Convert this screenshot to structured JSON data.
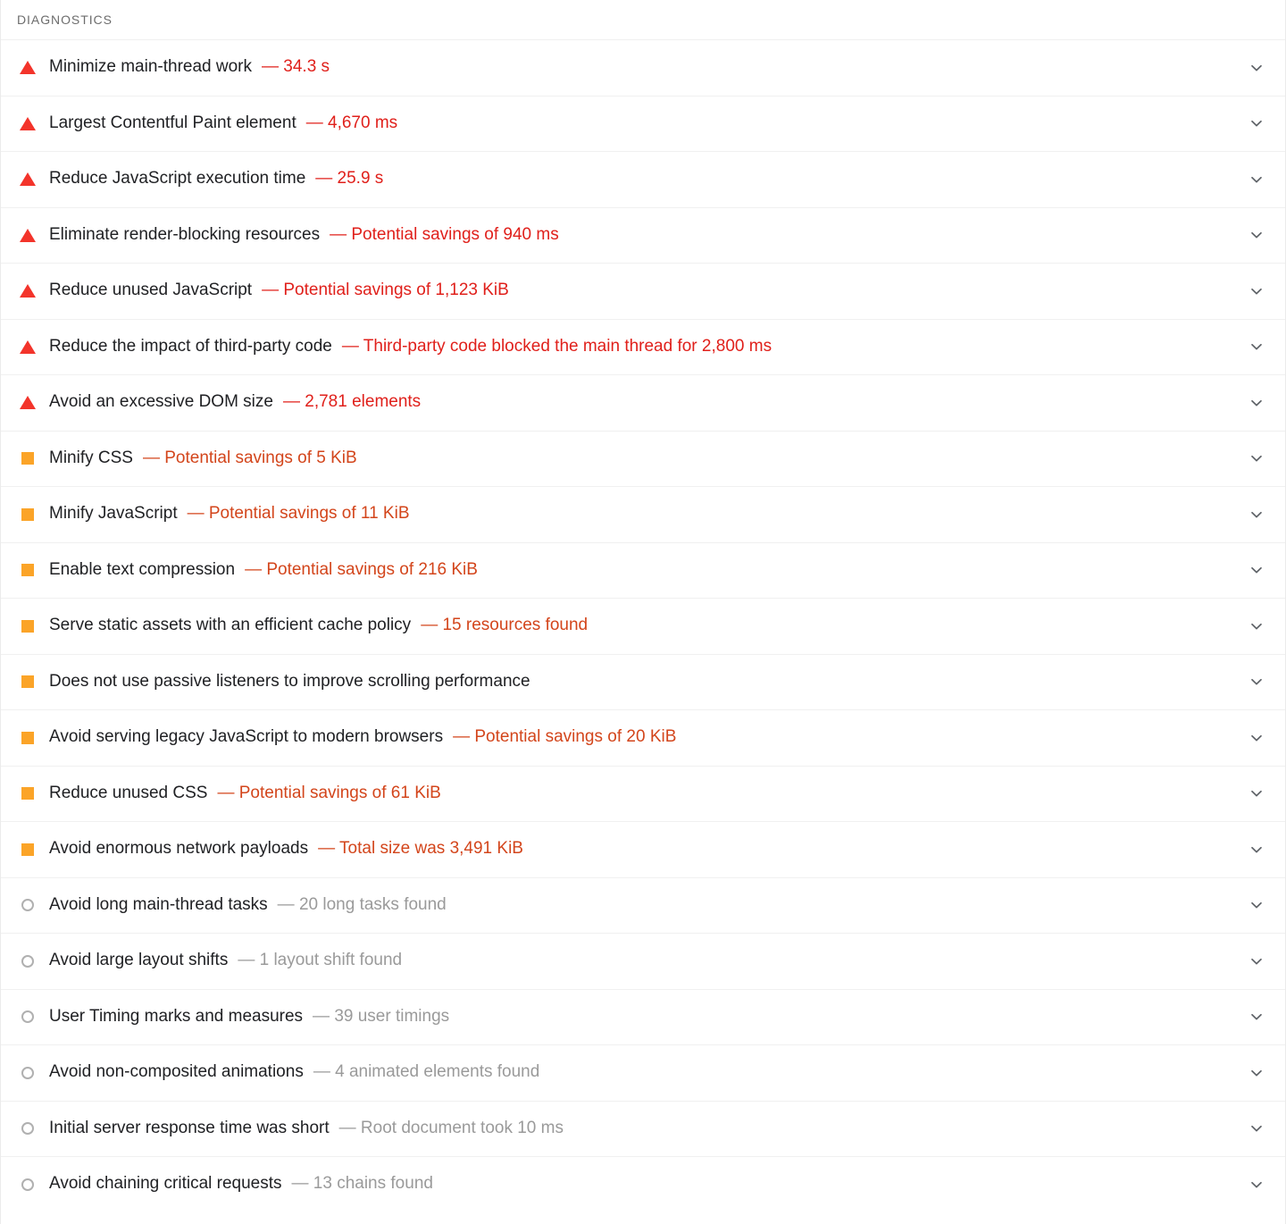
{
  "section": {
    "header_label": "DIAGNOSTICS"
  },
  "colors": {
    "error": "#e0201b",
    "error_icon": "#f3342b",
    "warning": "#d3451b",
    "warning_icon": "#fba428",
    "pass": "#9a9a9a",
    "pass_icon": "#b0b0b0",
    "title_text": "#202124",
    "header_text": "#6d6d6d",
    "row_divider": "#f0f0f0"
  },
  "icons": {
    "error": "red-triangle-icon",
    "warning": "orange-square-icon",
    "pass": "gray-circle-icon",
    "expand": "chevron-down-icon"
  },
  "audits": [
    {
      "severity": "error",
      "title": "Minimize main-thread work",
      "value": "— 34.3 s"
    },
    {
      "severity": "error",
      "title": "Largest Contentful Paint element",
      "value": "— 4,670 ms"
    },
    {
      "severity": "error",
      "title": "Reduce JavaScript execution time",
      "value": "— 25.9 s"
    },
    {
      "severity": "error",
      "title": "Eliminate render-blocking resources",
      "value": "— Potential savings of 940 ms"
    },
    {
      "severity": "error",
      "title": "Reduce unused JavaScript",
      "value": "— Potential savings of 1,123 KiB"
    },
    {
      "severity": "error",
      "title": "Reduce the impact of third-party code",
      "value": "— Third-party code blocked the main thread for 2,800 ms"
    },
    {
      "severity": "error",
      "title": "Avoid an excessive DOM size",
      "value": "— 2,781 elements"
    },
    {
      "severity": "warning",
      "title": "Minify CSS",
      "value": "— Potential savings of 5 KiB"
    },
    {
      "severity": "warning",
      "title": "Minify JavaScript",
      "value": "— Potential savings of 11 KiB"
    },
    {
      "severity": "warning",
      "title": "Enable text compression",
      "value": "— Potential savings of 216 KiB"
    },
    {
      "severity": "warning",
      "title": "Serve static assets with an efficient cache policy",
      "value": "— 15 resources found"
    },
    {
      "severity": "warning",
      "title": "Does not use passive listeners to improve scrolling performance",
      "value": ""
    },
    {
      "severity": "warning",
      "title": "Avoid serving legacy JavaScript to modern browsers",
      "value": "— Potential savings of 20 KiB"
    },
    {
      "severity": "warning",
      "title": "Reduce unused CSS",
      "value": "— Potential savings of 61 KiB"
    },
    {
      "severity": "warning",
      "title": "Avoid enormous network payloads",
      "value": "— Total size was 3,491 KiB"
    },
    {
      "severity": "pass",
      "title": "Avoid long main-thread tasks",
      "value": "— 20 long tasks found"
    },
    {
      "severity": "pass",
      "title": "Avoid large layout shifts",
      "value": "— 1 layout shift found"
    },
    {
      "severity": "pass",
      "title": "User Timing marks and measures",
      "value": "— 39 user timings"
    },
    {
      "severity": "pass",
      "title": "Avoid non-composited animations",
      "value": "— 4 animated elements found"
    },
    {
      "severity": "pass",
      "title": "Initial server response time was short",
      "value": "— Root document took 10 ms"
    },
    {
      "severity": "pass",
      "title": "Avoid chaining critical requests",
      "value": "— 13 chains found"
    }
  ]
}
